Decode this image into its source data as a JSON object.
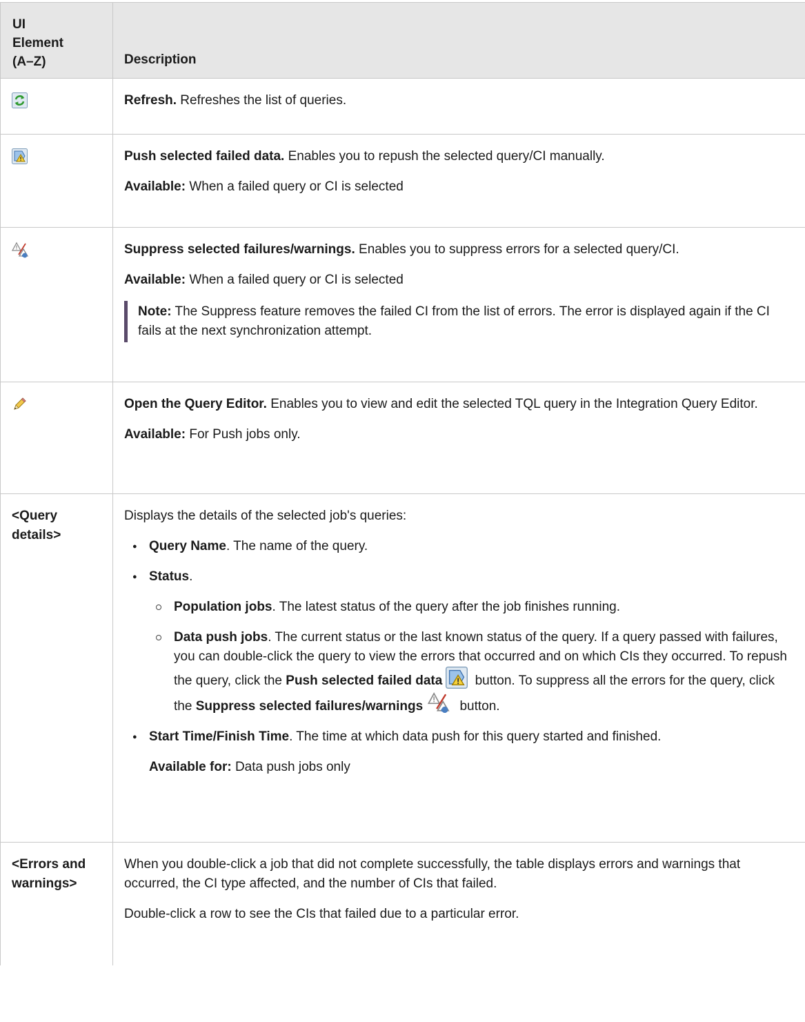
{
  "header": {
    "col1": [
      "UI",
      "Element",
      "(A–Z)"
    ],
    "col2": "Description"
  },
  "rows": {
    "refresh": {
      "icon": "refresh-icon",
      "title": "Refresh.",
      "text": " Refreshes the list of queries."
    },
    "push": {
      "icon": "push-failed-data-icon",
      "title": "Push selected failed data.",
      "text": " Enables you to repush the selected query/CI manually.",
      "avail_label": "Available:",
      "avail_text": " When a failed query or CI is selected"
    },
    "suppress": {
      "icon": "suppress-failures-icon",
      "title": "Suppress selected failures/warnings.",
      "text": " Enables you to suppress errors for a selected query/CI.",
      "avail_label": "Available:",
      "avail_text": " When a failed query or CI is selected",
      "note_label": "Note:",
      "note_text": "  The Suppress feature removes the failed CI from the list of errors. The error is displayed again if the CI fails at the next synchronization attempt."
    },
    "editor": {
      "icon": "pencil-icon",
      "title": "Open the Query Editor.",
      "text": " Enables you to view and edit the selected TQL query in the Integration Query Editor.",
      "avail_label": "Available:",
      "avail_text": " For Push jobs only."
    },
    "query_details": {
      "element": "<Query details>",
      "intro": "Displays the details of the selected job's queries:",
      "qname_label": "Query Name",
      "qname_text": ". The name of the query.",
      "status_label": "Status",
      "status_text": ".",
      "population_label": "Population jobs",
      "population_text": ". The latest status of the query after the job finishes running.",
      "datapush_label": "Data push jobs",
      "datapush_text1": ". The current status or the last known status of the query. If a query passed with failures, you can double-click the query to view the errors that occurred and on which CIs they occurred. To repush the query, click the ",
      "datapush_push_label": "Push selected failed data",
      "datapush_text2": " button. To suppress all the errors for the query, click the ",
      "datapush_suppress_label": "Suppress selected failures/warnings",
      "datapush_text3": " button.",
      "time_label": "Start Time/Finish Time",
      "time_text": ". The time at which data push for this query started and finished.",
      "avail_label": "Available for:",
      "avail_text": " Data push jobs only"
    },
    "errors": {
      "element": "<Errors and warnings>",
      "text1": "When you double-click a job that did not complete successfully, the table displays errors and warnings that occurred, the CI type affected, and the number of CIs that failed.",
      "text2": "Double-click a row to see the CIs that failed due to a particular error."
    }
  },
  "colors": {
    "header_bg": "#e6e6e6",
    "border": "#c8c8c8",
    "note_bar": "#5a4a6a"
  }
}
